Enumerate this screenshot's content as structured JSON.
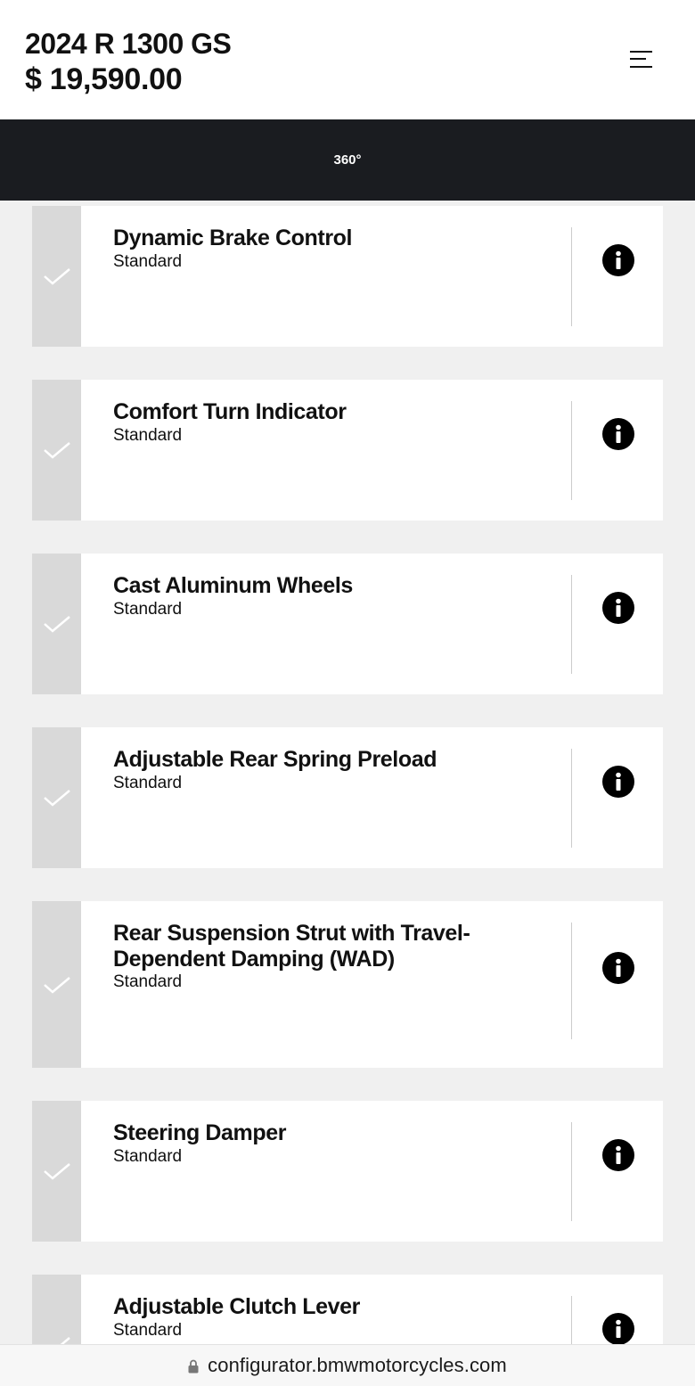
{
  "header": {
    "model": "2024 R 1300 GS",
    "price": "$ 19,590.00",
    "menu_icon": "hamburger-menu-icon"
  },
  "view_bar": {
    "label": "360°"
  },
  "features": [
    {
      "title": "Dynamic Brake Control",
      "status": "Standard",
      "selected": true
    },
    {
      "title": "Comfort Turn Indicator",
      "status": "Standard",
      "selected": true
    },
    {
      "title": "Cast Aluminum Wheels",
      "status": "Standard",
      "selected": true
    },
    {
      "title": "Adjustable Rear Spring Preload",
      "status": "Standard",
      "selected": true
    },
    {
      "title": "Rear Suspension Strut with Travel-Dependent Damping (WAD)",
      "status": "Standard",
      "selected": true
    },
    {
      "title": "Steering Damper",
      "status": "Standard",
      "selected": true
    },
    {
      "title": "Adjustable Clutch Lever",
      "status": "Standard",
      "selected": true
    }
  ],
  "browser": {
    "url": "configurator.bmwmotorcycles.com",
    "lock_icon": "lock-icon"
  },
  "colors": {
    "dark_bar": "#1a1c20",
    "check_column": "#d9d9d9",
    "page_background": "#f0f0f0",
    "card_background": "#ffffff"
  }
}
